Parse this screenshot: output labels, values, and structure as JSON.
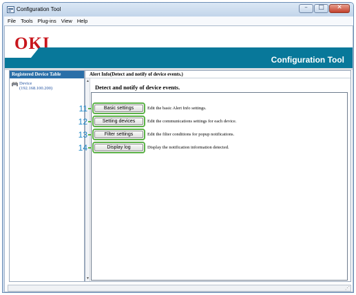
{
  "window": {
    "title": "Configuration Tool"
  },
  "menu": [
    "File",
    "Tools",
    "Plug-ins",
    "View",
    "Help"
  ],
  "banner": {
    "logo": "OKI",
    "title": "Configuration Tool"
  },
  "side": {
    "header": "Registered Device Table",
    "device": {
      "name": "Device",
      "ip": "(192.168.100.200)"
    }
  },
  "main": {
    "header": "Alert Info(Detect and notify of device events.)",
    "section_title": "Detect and notify of device events.",
    "actions": [
      {
        "number": "11",
        "button": "Basic settings",
        "description": "Edit the basic Alert Info settings."
      },
      {
        "number": "12",
        "button": "Setting devices",
        "description": "Edit the communications settings for each device."
      },
      {
        "number": "13",
        "button": "Filter settings",
        "description": "Edit the filter conditions for popup notifications."
      },
      {
        "number": "14",
        "button": "Display log",
        "description": "Display the notification information detected."
      }
    ]
  },
  "colors": {
    "brand_red": "#c8161d",
    "teal": "#08789a",
    "callout_green": "#5ab046",
    "callout_blue": "#1b86c6",
    "header_blue": "#2a6fa8"
  },
  "icons": [
    "app-icon",
    "printer-icon",
    "minimize-icon",
    "maximize-icon",
    "close-icon"
  ]
}
